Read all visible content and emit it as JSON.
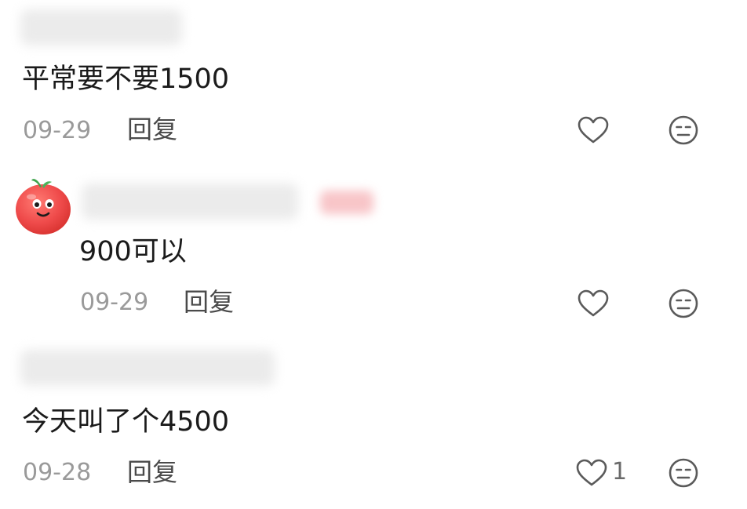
{
  "comments": [
    {
      "text": "平常要不要1500",
      "date": "09-29",
      "reply_label": "回复",
      "like_count": "",
      "avatar_icon": "none"
    },
    {
      "text": "900可以",
      "date": "09-29",
      "reply_label": "回复",
      "like_count": "",
      "avatar_icon": "tomato-avatar-icon"
    },
    {
      "text": "今天叫了个4500",
      "date": "09-28",
      "reply_label": "回复",
      "like_count": "1",
      "avatar_icon": "none"
    }
  ],
  "icons": {
    "like": "heart-outline-icon",
    "dislike": "neutral-face-icon"
  },
  "colors": {
    "text": "#1b1b1b",
    "meta": "#9a9a9a",
    "icon": "#5a5a5a",
    "avatar": "#ef4b4b"
  }
}
